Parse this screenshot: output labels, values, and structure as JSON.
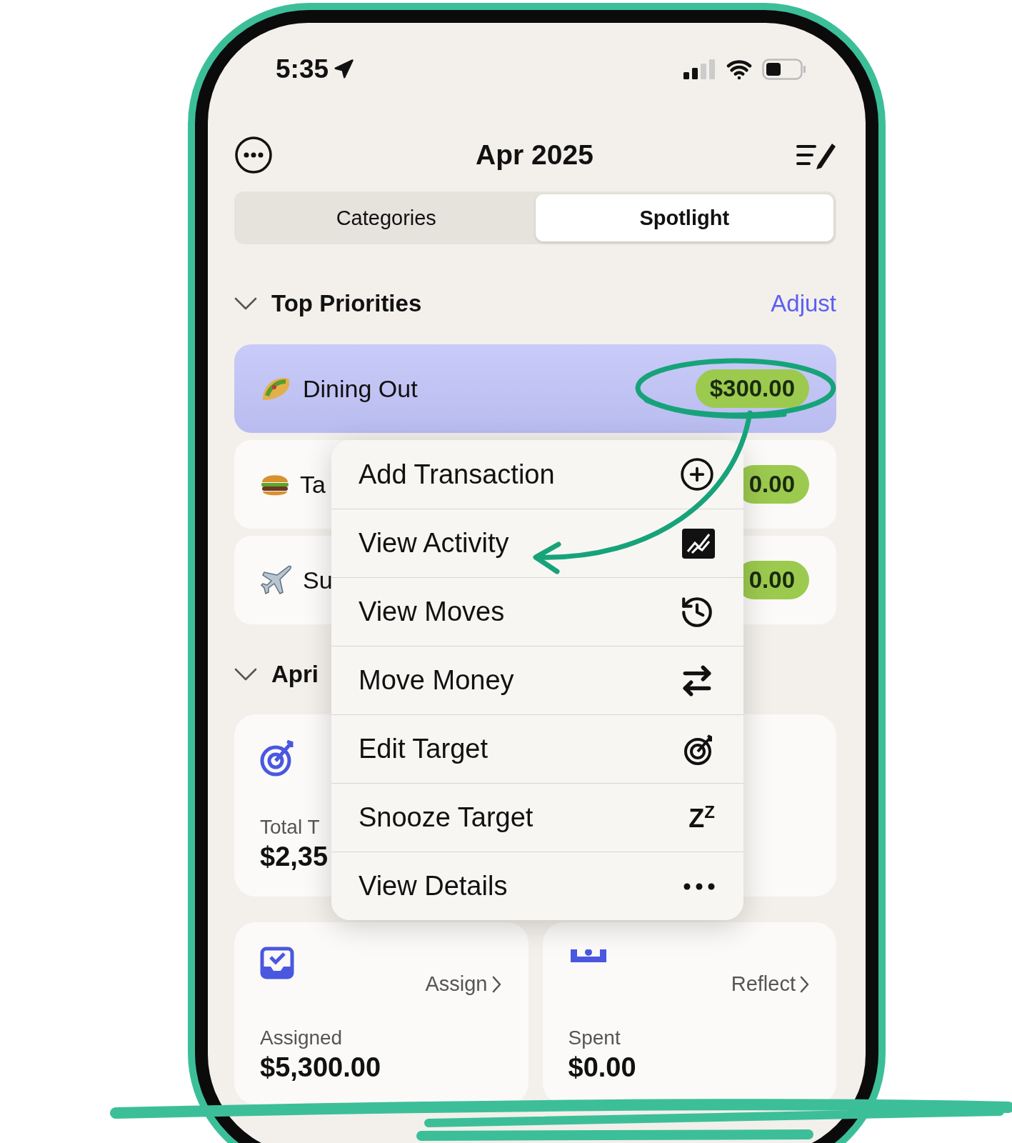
{
  "status_bar": {
    "time": "5:35"
  },
  "header": {
    "title": "Apr 2025"
  },
  "segments": [
    {
      "label": "Categories",
      "selected": false
    },
    {
      "label": "Spotlight",
      "selected": true
    }
  ],
  "priorities": {
    "title": "Top Priorities",
    "expanded": true,
    "action": "Adjust",
    "items": [
      {
        "kind": "taco",
        "name": "Dining Out",
        "amount": "$300.00",
        "highlighted": true
      },
      {
        "kind": "burger",
        "name": "Ta",
        "amount": "0.00",
        "highlighted": false
      },
      {
        "kind": "plane",
        "name": "Su",
        "amount": "0.00",
        "highlighted": false
      }
    ]
  },
  "month_section": {
    "title": "Apri",
    "expanded": true,
    "total_card": {
      "label": "Total T",
      "value": "$2,35"
    }
  },
  "summary_cards": [
    {
      "kind": "assign",
      "action": "Assign",
      "label": "Assigned",
      "value": "$5,300.00"
    },
    {
      "kind": "reflect",
      "action": "Reflect",
      "label": "Spent",
      "value": "$0.00"
    }
  ],
  "context_menu": {
    "items": [
      {
        "kind": "add",
        "label": "Add Transaction"
      },
      {
        "kind": "activity",
        "label": "View Activity"
      },
      {
        "kind": "moves",
        "label": "View Moves"
      },
      {
        "kind": "move",
        "label": "Move Money"
      },
      {
        "kind": "target",
        "label": "Edit Target"
      },
      {
        "kind": "snooze",
        "label": "Snooze Target",
        "glyph": "Z$^{Z}$"
      },
      {
        "kind": "details",
        "label": "View Details"
      }
    ]
  }
}
